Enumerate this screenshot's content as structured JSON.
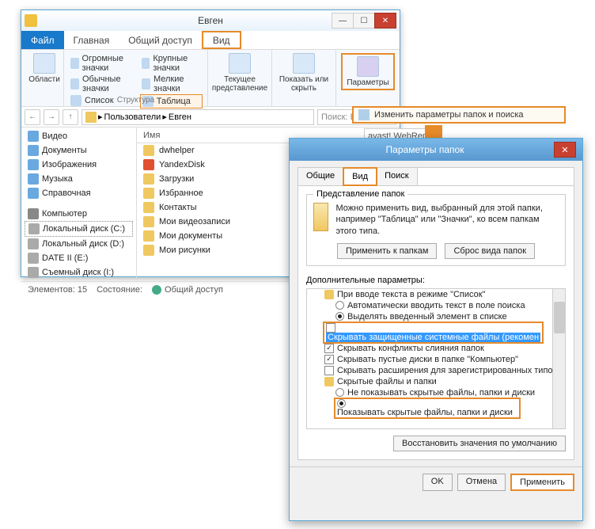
{
  "explorer": {
    "title": "Евген",
    "tabs": {
      "file": "Файл",
      "home": "Главная",
      "share": "Общий доступ",
      "view": "Вид"
    },
    "ribbon": {
      "areas_label": "Области",
      "layouts": {
        "huge": "Огромные значки",
        "large": "Крупные значки",
        "medium": "Обычные значки",
        "small": "Мелкие значки",
        "list": "Список",
        "details": "Таблица"
      },
      "group_struct": "Структура",
      "current_view": "Текущее представление",
      "show_hide": "Показать или скрыть",
      "options": "Параметры",
      "options_item": "Изменить параметры папок и поиска"
    },
    "breadcrumb": {
      "users": "Пользователи",
      "name": "Евген"
    },
    "search_ph": "Поиск: Евген",
    "webrep": "avast! WebRep",
    "col_name": "Имя",
    "nav": {
      "video": "Видео",
      "docs": "Документы",
      "pics": "Изображения",
      "music": "Музыка",
      "help": "Справочная",
      "computer": "Компьютер",
      "disk_c": "Локальный диск (C:)",
      "disk_d": "Локальный диск (D:)",
      "disk_e": "DATE II (E:)",
      "disk_remov": "Съемный диск (I:)"
    },
    "files": {
      "dwhelper": "dwhelper",
      "yadisk": "YandexDisk",
      "downloads": "Загрузки",
      "favorites": "Избранное",
      "contacts": "Контакты",
      "videos": "Мои видеозаписи",
      "mydocs": "Мои документы",
      "mypics": "Мои рисунки"
    },
    "status": {
      "elements": "Элементов: 15",
      "state": "Состояние:",
      "shared": "Общий доступ"
    }
  },
  "dialog": {
    "title": "Параметры папок",
    "tabs": {
      "general": "Общие",
      "view": "Вид",
      "search": "Поиск"
    },
    "folder_view": {
      "legend": "Представление папок",
      "desc": "Можно применить вид, выбранный для этой папки, например \"Таблица\" или \"Значки\", ко всем папкам этого типа.",
      "apply": "Применить к папкам",
      "reset": "Сброс вида папок"
    },
    "adv_label": "Дополнительные параметры:",
    "tree": {
      "typing": "При вводе текста в режиме \"Список\"",
      "auto_type": "Автоматически вводить текст в поле поиска",
      "highlight": "Выделять введенный элемент в списке",
      "hide_protected": "Скрывать защищенные системные файлы (рекомен",
      "hide_merge": "Скрывать конфликты слияния папок",
      "hide_empty": "Скрывать пустые диски в папке \"Компьютер\"",
      "hide_ext": "Скрывать расширения для зарегистрированных типо",
      "hidden_group": "Скрытые файлы и папки",
      "dont_show": "Не показывать скрытые файлы, папки и диски",
      "show_hidden": "Показывать скрытые файлы, папки и диски"
    },
    "restore": "Восстановить значения по умолчанию",
    "btns": {
      "ok": "OK",
      "cancel": "Отмена",
      "apply": "Применить"
    }
  }
}
